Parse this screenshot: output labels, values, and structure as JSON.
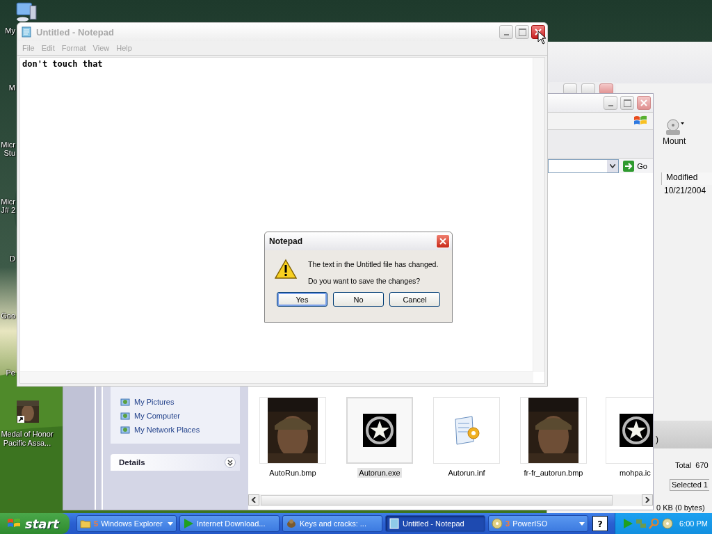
{
  "desktop": {
    "icons": [
      {
        "kind": "computer",
        "lines": [
          "My"
        ]
      },
      {
        "kind": "plain",
        "lines": [
          "M"
        ]
      },
      {
        "kind": "plain",
        "lines": [
          "Micr",
          "Stu"
        ]
      },
      {
        "kind": "plain",
        "lines": [
          "Micr",
          "J# 2"
        ]
      },
      {
        "kind": "plain",
        "lines": [
          "D"
        ]
      },
      {
        "kind": "plain",
        "lines": [
          "Goo"
        ]
      },
      {
        "kind": "plain",
        "lines": [
          "Pe"
        ]
      }
    ],
    "shortcut": {
      "lines": [
        "Medal of Honor",
        "Pacific Assa..."
      ]
    }
  },
  "poweriso_window": {
    "toolbar_button": "Mount",
    "column": "Modified",
    "date": "10/21/2004",
    "status_1": ")",
    "total": "Total  670",
    "selected": "Selected 1",
    "status_2": "0 KB (0 bytes)"
  },
  "explorer_window": {
    "go_button": "Go",
    "tasks": [
      "My Pictures",
      "My Computer",
      "My Network Places"
    ],
    "details": "Details",
    "files": [
      {
        "name": "AutoRun.bmp",
        "kind": "picture",
        "selected": false
      },
      {
        "name": "Autorun.exe",
        "kind": "star",
        "selected": true
      },
      {
        "name": "Autorun.inf",
        "kind": "settings",
        "selected": false
      },
      {
        "name": "fr-fr_autorun.bmp",
        "kind": "picture",
        "selected": false
      },
      {
        "name": "mohpa.ic",
        "kind": "star",
        "selected": false
      }
    ]
  },
  "notepad": {
    "title": "Untitled - Notepad",
    "active": false,
    "menu": [
      "File",
      "Edit",
      "Format",
      "View",
      "Help"
    ],
    "text": "don't touch that"
  },
  "dialog": {
    "title": "Notepad",
    "lines": [
      "The text in the Untitled file has changed.",
      "Do you want to save the changes?"
    ],
    "buttons": [
      {
        "label": "Yes",
        "selected": true
      },
      {
        "label": "No",
        "selected": false
      },
      {
        "label": "Cancel",
        "selected": false
      }
    ]
  },
  "taskbar": {
    "start": "start",
    "buttons": [
      {
        "kind": "folder",
        "count": "5",
        "label": "Windows Explorer",
        "dropdown": true,
        "selected": false
      },
      {
        "kind": "play",
        "label": "Internet Download...",
        "dropdown": false,
        "selected": false
      },
      {
        "kind": "creature",
        "label": "Keys and cracks: ...",
        "dropdown": false,
        "selected": false
      },
      {
        "kind": "notepad",
        "label": "Untitled - Notepad",
        "dropdown": false,
        "selected": true
      },
      {
        "kind": "disc",
        "count": "3",
        "label": "PowerISO",
        "dropdown": true,
        "selected": false
      }
    ],
    "help": "?",
    "clock": "6:00 PM"
  }
}
